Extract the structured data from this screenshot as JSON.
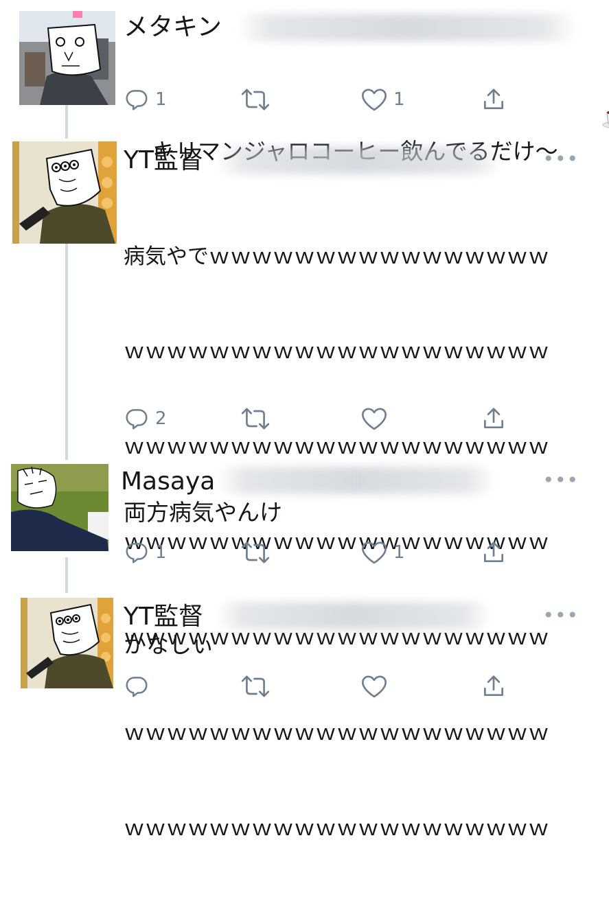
{
  "tweets": [
    {
      "name": "メタキン",
      "text": "キリマンジャロコーヒー飲んでるだけ〜",
      "emoji": "coffee-cup-icon",
      "reply_count": "1",
      "like_count": "1",
      "show_more": false
    },
    {
      "name": "YT監督",
      "text_lines": [
        "病気やでｗｗｗｗｗｗｗｗｗｗｗｗｗｗｗｗ",
        "ｗｗｗｗｗｗｗｗｗｗｗｗｗｗｗｗｗｗｗｗ",
        "ｗｗｗｗｗｗｗｗｗｗｗｗｗｗｗｗｗｗｗｗ",
        "ｗｗｗｗｗｗｗｗｗｗｗｗｗｗｗｗｗｗｗｗ",
        "ｗｗｗｗｗｗｗｗｗｗｗｗｗｗｗｗｗｗｗｗ",
        "ｗｗｗｗｗｗｗｗｗｗｗｗｗｗｗｗｗｗｗｗ",
        "ｗｗｗｗｗｗｗｗｗｗｗｗｗｗｗｗｗｗｗｗ"
      ],
      "reply_count": "2",
      "like_count": "",
      "more_label": "•••"
    },
    {
      "name": "Masaya",
      "text": "両方病気やんけ",
      "reply_count": "1",
      "like_count": "1",
      "more_label": "•••"
    },
    {
      "name": "YT監督",
      "text": "かなしぃ",
      "reply_count": "",
      "like_count": "",
      "more_label": "•••"
    }
  ],
  "colors": {
    "icon": "#6f7f8f",
    "thread_line": "#cfd9de",
    "text": "#14171a"
  }
}
